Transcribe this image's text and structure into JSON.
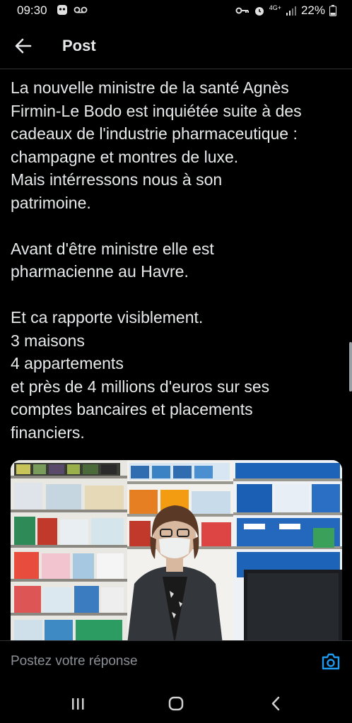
{
  "status_bar": {
    "time": "09:30",
    "battery": "22%",
    "network": "4G+"
  },
  "header": {
    "title": "Post"
  },
  "post": {
    "text": "La nouvelle ministre de la santé Agnès\nFirmin-Le Bodo est inquiétée suite à des\ncadeaux de l'industrie pharmaceutique :\nchampagne et montres de luxe.\nMais intérressons nous à son\npatrimoine.\n\nAvant d'être ministre elle est\npharmacienne au Havre.\n\nEt ca rapporte visiblement.\n3 maisons\n4 appartements\net près de 4 millions d'euros sur ses\ncomptes bancaires et placements\nfinanciers."
  },
  "reply": {
    "placeholder": "Postez votre réponse"
  },
  "icons": {
    "back": "arrow-left-icon",
    "camera": "camera-icon",
    "recents": "recent-apps-icon",
    "home": "home-icon",
    "nav_back": "chevron-left-icon"
  },
  "colors": {
    "background": "#000000",
    "text": "#e7e9ea",
    "muted": "#8b9096",
    "accent": "#1d9bf0"
  }
}
